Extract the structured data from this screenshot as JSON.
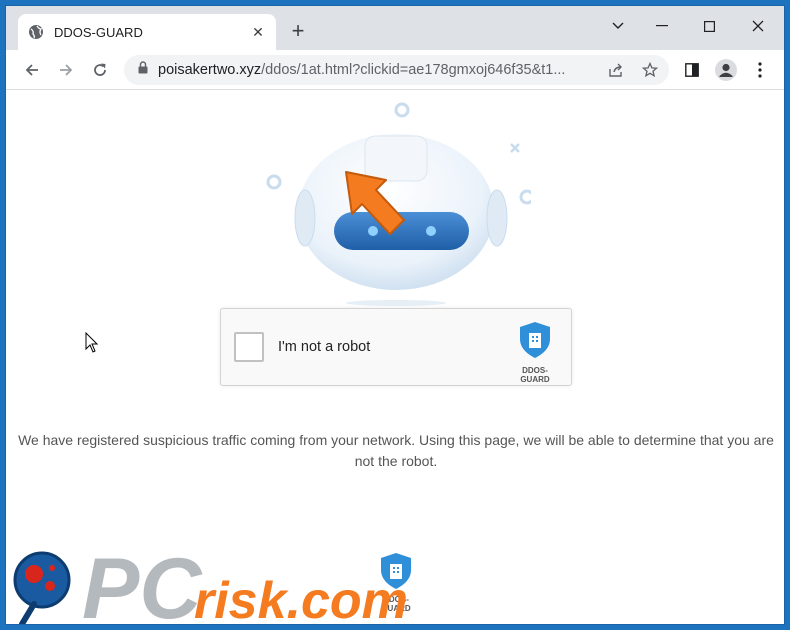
{
  "tab": {
    "title": "DDOS-GUARD",
    "icon": "globe-icon"
  },
  "window_controls": {
    "chevron": "chevron-down-icon",
    "minimize": "minimize-icon",
    "maximize": "maximize-icon",
    "close": "close-icon"
  },
  "toolbar": {
    "url_domain": "poisakertwo.xyz",
    "url_path": "/ddos/1at.html?clickid=ae178gmxoj646f35&t1..."
  },
  "captcha": {
    "label": "I'm not a robot",
    "logo_text": "DDOS-GUARD"
  },
  "message": "We have registered suspicious traffic coming from your network. Using this page, we will be able to determine that you are not the robot.",
  "footer": {
    "logo_text": "DDOS-GUARD"
  },
  "watermark": {
    "text": "PCrisk.com"
  },
  "colors": {
    "accent": "#1e73be",
    "shield": "#2f8fd8",
    "arrow": "#f47b20",
    "watermark_red": "#d9261c"
  }
}
